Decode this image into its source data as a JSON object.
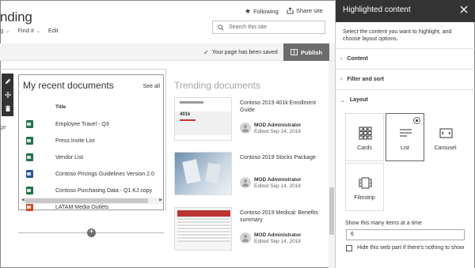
{
  "site": {
    "title": "nding",
    "nav": [
      "g",
      "Find it",
      "Edit"
    ],
    "following": "Following",
    "share": "Share site",
    "search_placeholder": "Search this site"
  },
  "commandbar": {
    "saved_message": "Your page has been saved",
    "publish_label": "Publish"
  },
  "canvas": {
    "left_stray_text": "ge",
    "recent": {
      "title": "My recent documents",
      "see_all": "See all",
      "column_title": "Title",
      "documents": [
        {
          "name": "Employee Travel - Q3",
          "type": "excel"
        },
        {
          "name": "Press Invite List",
          "type": "excel"
        },
        {
          "name": "Vendor List",
          "type": "excel"
        },
        {
          "name": "Contoso Pricings Guidelines Version 2.0",
          "type": "word"
        },
        {
          "name": "Contoso Purchasing Data - Q1 KJ copy",
          "type": "excel"
        },
        {
          "name": "LATAM Media Outlets",
          "type": "powerpoint"
        }
      ]
    },
    "trending": {
      "title": "Trending documents",
      "items": [
        {
          "name": "Contoso 2019 401k Enrollment Guide",
          "author": "MOD Administrator",
          "date": "Edited Sep 14, 2018",
          "thumb_text": "401k"
        },
        {
          "name": "Contoso 2019 Stocks Package",
          "author": "MOD Administrator",
          "date": "Edited Sep 14, 2018",
          "thumb_text": ""
        },
        {
          "name": "Contoso 2019 Medical: Benefits summary",
          "author": "MOD Administrator",
          "date": "Edited Sep 14, 2018",
          "thumb_text": ""
        }
      ]
    }
  },
  "panel": {
    "title": "Highlighted content",
    "description": "Select the content you want to highlight, and choose layout options.",
    "sections": [
      "Content",
      "Filter and sort",
      "Layout"
    ],
    "layout_options": [
      "Cards",
      "List",
      "Carousel",
      "Filmstrip"
    ],
    "selected_layout": "List",
    "items_label": "Show this many items at a time",
    "items_value": "6",
    "hide_label": "Hide this web part if there's nothing to show"
  },
  "colors": {
    "excel": "#217346",
    "word": "#2b579a",
    "powerpoint": "#d24726",
    "panel_header": "#333333",
    "publish_bg": "#6c6c6c"
  }
}
